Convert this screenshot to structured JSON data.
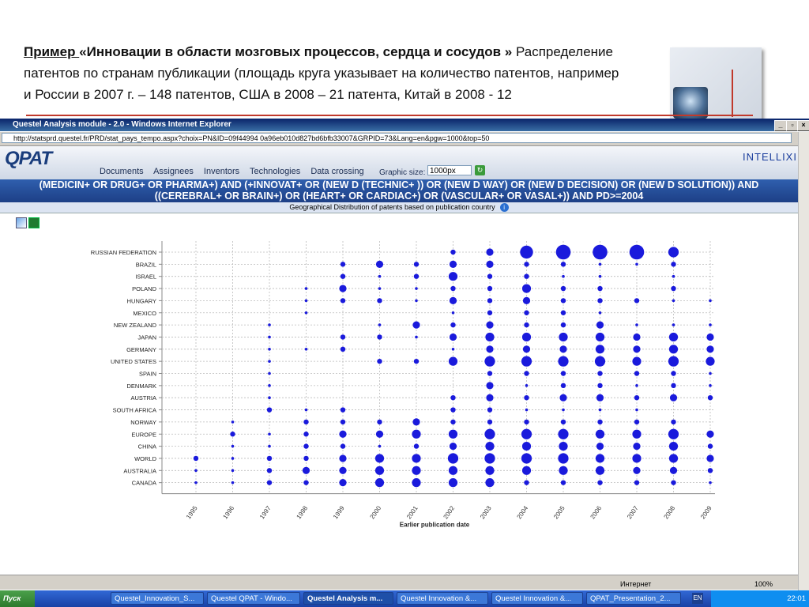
{
  "slide": {
    "lead": "Пример ",
    "quote_open": "«",
    "quote_title": "Инновации в области  мозговых процессов, сердца и сосудов",
    "quote_close": " »",
    "line1_rest": "   Распределение",
    "line2": "патентов по странам публикации (площадь  круга указывает на  количество патентов, например",
    "line3": "и  России в 2007 г. – 148 патентов, США  в 2008 – 21 патента, Китай в 2008 - 12"
  },
  "window": {
    "title": "Questel Analysis module - 2.0 - Windows Internet Explorer",
    "address": "http://statsprd.questel.fr/PRD/stat_pays_tempo.aspx?choix=PN&ID=09f44994 0a96eb010d827bd6bfb33007&GRPID=73&Lang=en&pgw=1000&top=50",
    "min_label": "_",
    "max_label": "▫",
    "close_label": "×"
  },
  "app": {
    "logo": "QPAT",
    "menu": [
      "Documents",
      "Assignees",
      "Inventors",
      "Technologies",
      "Data crossing"
    ],
    "graphic_size_label": "Graphic size:",
    "graphic_size_value": "1000px",
    "brand": "INTELLIXIR",
    "query_line1": "(MEDICIN+ OR DRUG+ OR PHARMA+) AND (+INNOVAT+ OR (NEW D (TECHNIC+ )) OR (NEW D WAY) OR (NEW D DECISION) OR (NEW D SOLUTION)) AND",
    "query_line2": "((CEREBRAL+ OR BRAIN+) OR (HEART+ OR CARDIAC+) OR (VASCULAR+ OR VASAL+)) AND PD>=2004",
    "chart_title": "Geographical Distribution of patents based on publication country",
    "info_icon": "i"
  },
  "chart_data": {
    "type": "scatter",
    "xlabel": "Earlier publication date",
    "years": [
      "1995",
      "1996",
      "1997",
      "1998",
      "1999",
      "2000",
      "2001",
      "2002",
      "2003",
      "2004",
      "2005",
      "2006",
      "2007",
      "2008",
      "2009"
    ],
    "countries": [
      "RUSSIAN FEDERATION",
      "BRAZIL",
      "ISRAEL",
      "POLAND",
      "HUNGARY",
      "MEXICO",
      "NEW ZEALAND",
      "JAPAN",
      "GERMANY",
      "UNITED STATES",
      "SPAIN",
      "DENMARK",
      "AUSTRIA",
      "SOUTH AFRICA",
      "NORWAY",
      "EUROPE",
      "CHINA",
      "WORLD",
      "AUSTRALIA",
      "CANADA"
    ],
    "size_scale": "dot area represents number of patents; values are relative levels 0-7",
    "sizes": [
      [
        0,
        0,
        0,
        0,
        0,
        0,
        0,
        2,
        3,
        6,
        7,
        7,
        7,
        5,
        0
      ],
      [
        0,
        0,
        0,
        0,
        2,
        3,
        2,
        3,
        3,
        2,
        2,
        1,
        1,
        2,
        0
      ],
      [
        0,
        0,
        0,
        0,
        2,
        1,
        2,
        4,
        2,
        2,
        1,
        1,
        0,
        1,
        0
      ],
      [
        0,
        0,
        0,
        1,
        3,
        1,
        1,
        2,
        2,
        4,
        2,
        2,
        0,
        2,
        0
      ],
      [
        0,
        0,
        0,
        1,
        2,
        2,
        1,
        3,
        2,
        3,
        2,
        2,
        2,
        1,
        1
      ],
      [
        0,
        0,
        0,
        1,
        0,
        0,
        0,
        1,
        2,
        2,
        2,
        1,
        0,
        0,
        0
      ],
      [
        0,
        0,
        1,
        0,
        0,
        1,
        3,
        2,
        3,
        2,
        2,
        3,
        1,
        1,
        1
      ],
      [
        0,
        0,
        1,
        0,
        2,
        2,
        1,
        3,
        4,
        4,
        4,
        4,
        3,
        4,
        3
      ],
      [
        0,
        0,
        1,
        1,
        2,
        0,
        0,
        1,
        3,
        3,
        3,
        4,
        3,
        4,
        3
      ],
      [
        0,
        0,
        1,
        0,
        0,
        2,
        2,
        4,
        5,
        5,
        5,
        5,
        4,
        5,
        4
      ],
      [
        0,
        0,
        1,
        0,
        0,
        0,
        0,
        0,
        2,
        2,
        2,
        2,
        2,
        2,
        1
      ],
      [
        0,
        0,
        1,
        0,
        0,
        0,
        0,
        0,
        3,
        1,
        2,
        2,
        1,
        2,
        1
      ],
      [
        0,
        0,
        1,
        0,
        0,
        0,
        0,
        2,
        3,
        2,
        3,
        3,
        2,
        3,
        2
      ],
      [
        0,
        0,
        2,
        1,
        2,
        0,
        0,
        2,
        2,
        1,
        1,
        1,
        1,
        0,
        0
      ],
      [
        0,
        1,
        0,
        2,
        2,
        2,
        3,
        2,
        2,
        2,
        2,
        2,
        2,
        2,
        0
      ],
      [
        0,
        2,
        1,
        2,
        3,
        3,
        4,
        4,
        5,
        5,
        5,
        4,
        4,
        5,
        3
      ],
      [
        0,
        1,
        1,
        2,
        2,
        1,
        2,
        3,
        4,
        4,
        4,
        3,
        3,
        4,
        2
      ],
      [
        2,
        1,
        2,
        2,
        3,
        4,
        4,
        5,
        5,
        5,
        5,
        4,
        4,
        4,
        3
      ],
      [
        1,
        1,
        2,
        3,
        3,
        4,
        4,
        4,
        4,
        4,
        4,
        4,
        3,
        3,
        2
      ],
      [
        1,
        1,
        2,
        2,
        3,
        4,
        4,
        4,
        4,
        2,
        2,
        2,
        2,
        2,
        1
      ]
    ]
  },
  "status": {
    "zone": "Интернет",
    "zoom": "100%"
  },
  "taskbar": {
    "start": "Пуск",
    "items": [
      "Questel_Innovation_S...",
      "Questel QPAT - Windo...",
      "Questel Analysis m...",
      "Questel  Innovation &...",
      "Questel  Innovation &...",
      "QPAT_Presentation_2..."
    ],
    "lang": "EN",
    "clock": "22:01"
  }
}
